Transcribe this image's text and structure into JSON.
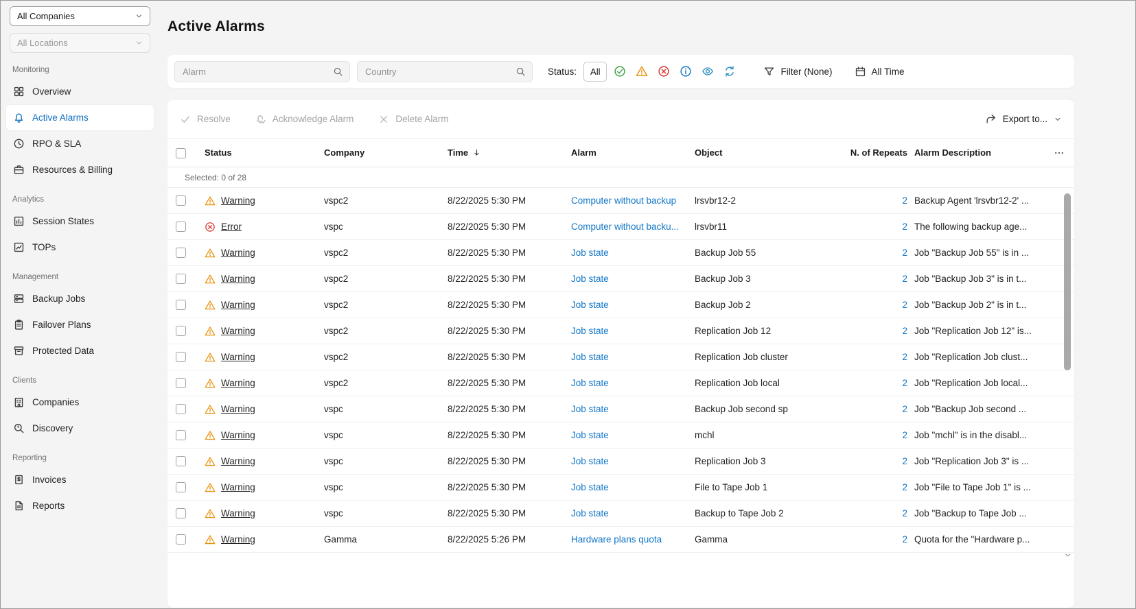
{
  "colors": {
    "accent": "#0e6fc1",
    "link": "#1076c8",
    "success": "#3ba13f",
    "warning": "#e8920c",
    "error": "#d9342b",
    "info": "#1076c8"
  },
  "sidebar": {
    "company_select": {
      "value": "All Companies"
    },
    "location_select": {
      "value": "All Locations"
    },
    "sections": [
      {
        "label": "Monitoring",
        "items": [
          {
            "label": "Overview",
            "icon": "grid",
            "active": false
          },
          {
            "label": "Active Alarms",
            "icon": "bell",
            "active": true
          },
          {
            "label": "RPO & SLA",
            "icon": "clock",
            "active": false
          },
          {
            "label": "Resources & Billing",
            "icon": "briefcase",
            "active": false
          }
        ]
      },
      {
        "label": "Analytics",
        "items": [
          {
            "label": "Session States",
            "icon": "bars-box",
            "active": false
          },
          {
            "label": "TOPs",
            "icon": "chart-box",
            "active": false
          }
        ]
      },
      {
        "label": "Management",
        "items": [
          {
            "label": "Backup Jobs",
            "icon": "drives",
            "active": false
          },
          {
            "label": "Failover Plans",
            "icon": "clipboard",
            "active": false
          },
          {
            "label": "Protected Data",
            "icon": "archive",
            "active": false
          }
        ]
      },
      {
        "label": "Clients",
        "items": [
          {
            "label": "Companies",
            "icon": "building",
            "active": false
          },
          {
            "label": "Discovery",
            "icon": "radar",
            "active": false
          }
        ]
      },
      {
        "label": "Reporting",
        "items": [
          {
            "label": "Invoices",
            "icon": "invoice",
            "active": false
          },
          {
            "label": "Reports",
            "icon": "report",
            "active": false
          }
        ]
      }
    ]
  },
  "page": {
    "title": "Active Alarms"
  },
  "filters": {
    "alarm_search_placeholder": "Alarm",
    "country_search_placeholder": "Country",
    "status_label": "Status:",
    "status_buttons": [
      {
        "name": "all",
        "label": "All",
        "selected": true
      },
      {
        "name": "resolved",
        "icon": "check-circle",
        "color": "#3ba13f"
      },
      {
        "name": "warning",
        "icon": "warning-triangle",
        "color": "#e8920c"
      },
      {
        "name": "error",
        "icon": "error-circle",
        "color": "#d9342b"
      },
      {
        "name": "info",
        "icon": "info-circle",
        "color": "#1076c8"
      },
      {
        "name": "acknowledged",
        "icon": "eye",
        "color": "#2f8fbf"
      },
      {
        "name": "in-progress",
        "icon": "sync",
        "color": "#2f8fbf"
      }
    ],
    "filter_button": "Filter (None)",
    "time_button": "All Time"
  },
  "toolbar": {
    "resolve": "Resolve",
    "acknowledge": "Acknowledge Alarm",
    "delete": "Delete Alarm",
    "export": "Export to..."
  },
  "table": {
    "selected_summary": "Selected: 0 of 28",
    "columns": [
      "Status",
      "Company",
      "Time",
      "Alarm",
      "Object",
      "N. of Repeats",
      "Alarm Description"
    ],
    "rows": [
      {
        "severity": "warning",
        "status": "Warning",
        "company": "vspc2",
        "time": "8/22/2025 5:30 PM",
        "alarm": "Computer without backup",
        "object": "lrsvbr12-2",
        "repeats": "2",
        "description": "Backup Agent 'lrsvbr12-2' ..."
      },
      {
        "severity": "error",
        "status": "Error",
        "company": "vspc",
        "time": "8/22/2025 5:30 PM",
        "alarm": "Computer without backu...",
        "object": "lrsvbr11",
        "repeats": "2",
        "description": "The following backup age..."
      },
      {
        "severity": "warning",
        "status": "Warning",
        "company": "vspc2",
        "time": "8/22/2025 5:30 PM",
        "alarm": "Job state",
        "object": "Backup Job 55",
        "repeats": "2",
        "description": "Job \"Backup Job 55\" is in ..."
      },
      {
        "severity": "warning",
        "status": "Warning",
        "company": "vspc2",
        "time": "8/22/2025 5:30 PM",
        "alarm": "Job state",
        "object": "Backup Job 3",
        "repeats": "2",
        "description": "Job \"Backup Job 3\" is in t..."
      },
      {
        "severity": "warning",
        "status": "Warning",
        "company": "vspc2",
        "time": "8/22/2025 5:30 PM",
        "alarm": "Job state",
        "object": "Backup Job 2",
        "repeats": "2",
        "description": "Job \"Backup Job 2\" is in t..."
      },
      {
        "severity": "warning",
        "status": "Warning",
        "company": "vspc2",
        "time": "8/22/2025 5:30 PM",
        "alarm": "Job state",
        "object": "Replication Job 12",
        "repeats": "2",
        "description": "Job \"Replication Job 12\" is..."
      },
      {
        "severity": "warning",
        "status": "Warning",
        "company": "vspc2",
        "time": "8/22/2025 5:30 PM",
        "alarm": "Job state",
        "object": "Replication Job cluster",
        "repeats": "2",
        "description": "Job \"Replication Job clust..."
      },
      {
        "severity": "warning",
        "status": "Warning",
        "company": "vspc2",
        "time": "8/22/2025 5:30 PM",
        "alarm": "Job state",
        "object": "Replication Job local",
        "repeats": "2",
        "description": "Job \"Replication Job local..."
      },
      {
        "severity": "warning",
        "status": "Warning",
        "company": "vspc",
        "time": "8/22/2025 5:30 PM",
        "alarm": "Job state",
        "object": "Backup Job second sp",
        "repeats": "2",
        "description": "Job \"Backup Job second ..."
      },
      {
        "severity": "warning",
        "status": "Warning",
        "company": "vspc",
        "time": "8/22/2025 5:30 PM",
        "alarm": "Job state",
        "object": "mchl",
        "repeats": "2",
        "description": "Job \"mchl\" is in the disabl..."
      },
      {
        "severity": "warning",
        "status": "Warning",
        "company": "vspc",
        "time": "8/22/2025 5:30 PM",
        "alarm": "Job state",
        "object": "Replication Job 3",
        "repeats": "2",
        "description": "Job \"Replication Job 3\" is ..."
      },
      {
        "severity": "warning",
        "status": "Warning",
        "company": "vspc",
        "time": "8/22/2025 5:30 PM",
        "alarm": "Job state",
        "object": "File to Tape Job 1",
        "repeats": "2",
        "description": "Job \"File to Tape Job 1\" is ..."
      },
      {
        "severity": "warning",
        "status": "Warning",
        "company": "vspc",
        "time": "8/22/2025 5:30 PM",
        "alarm": "Job state",
        "object": "Backup to Tape Job 2",
        "repeats": "2",
        "description": "Job \"Backup to Tape Job ..."
      },
      {
        "severity": "warning",
        "status": "Warning",
        "company": "Gamma",
        "time": "8/22/2025 5:26 PM",
        "alarm": "Hardware plans quota",
        "object": "Gamma",
        "repeats": "2",
        "description": "Quota for the \"Hardware p..."
      }
    ]
  }
}
